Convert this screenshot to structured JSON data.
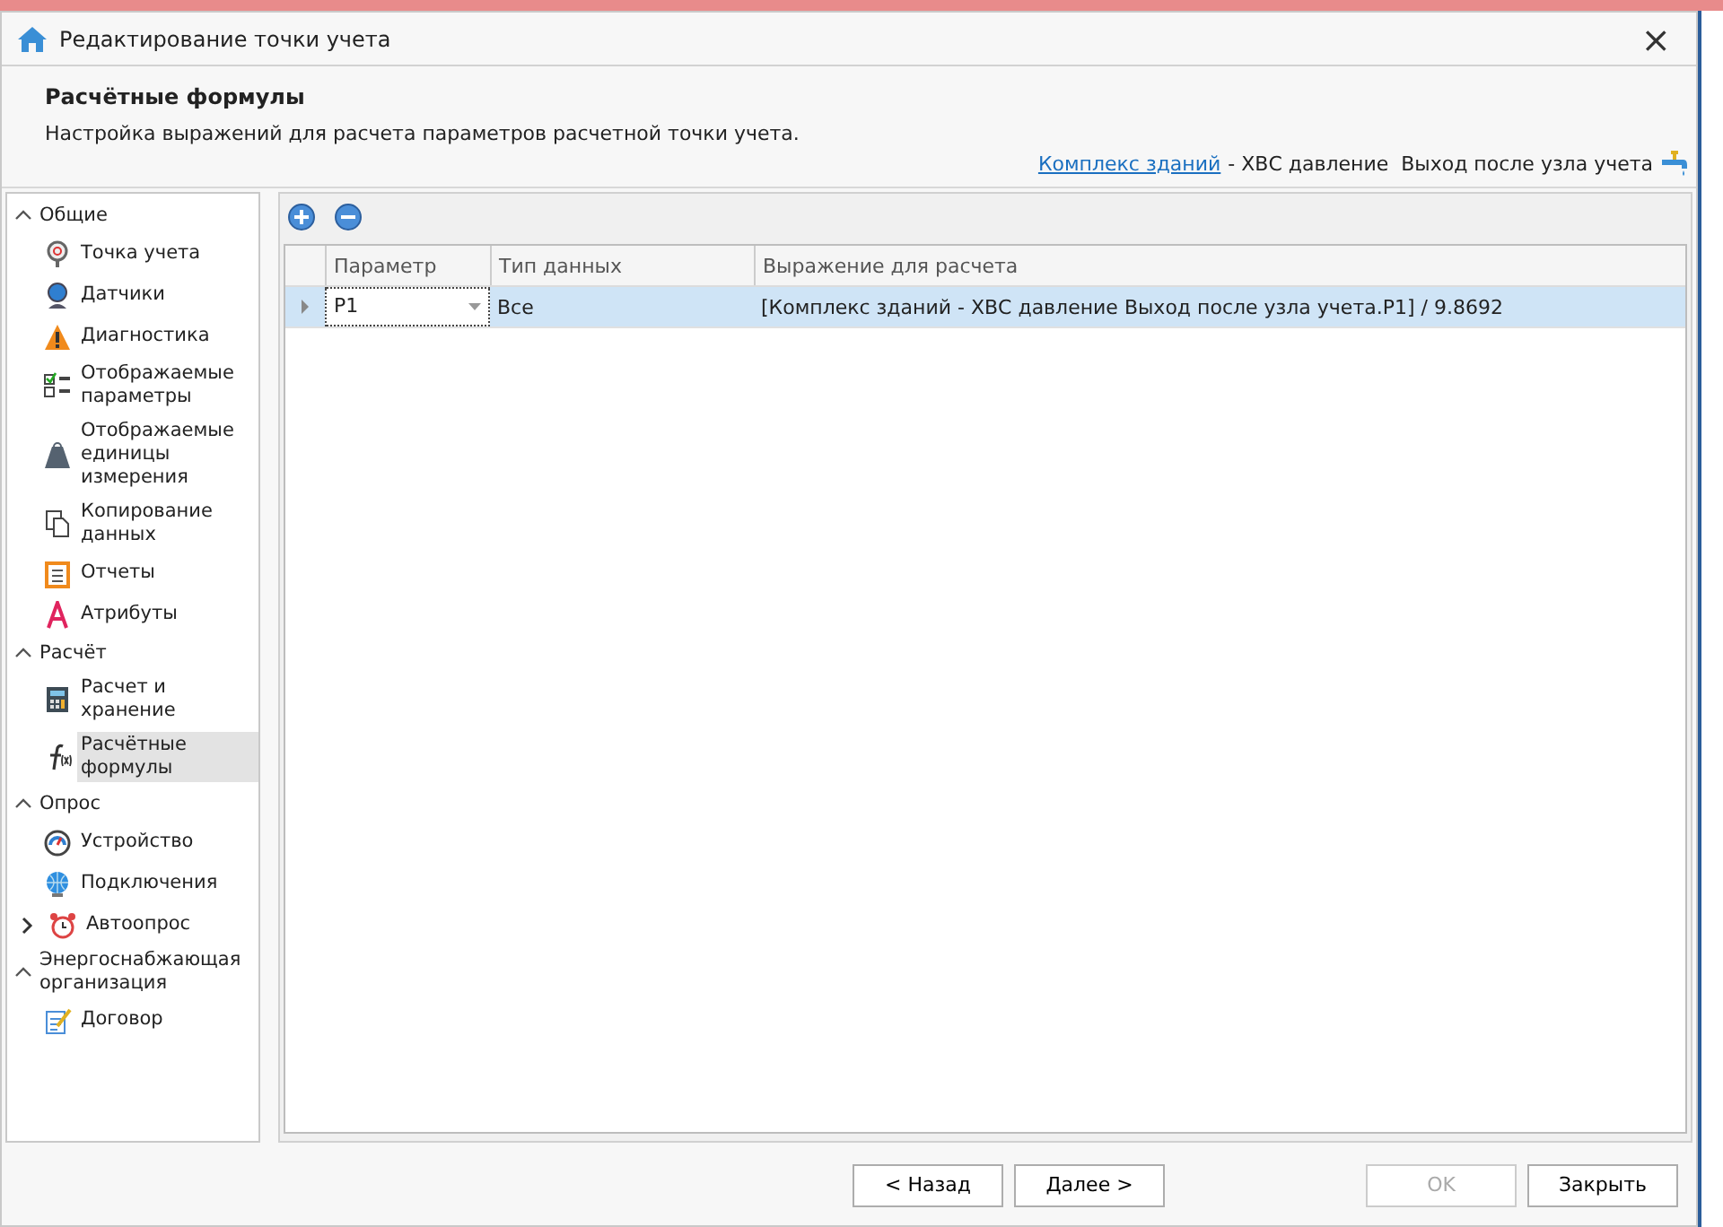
{
  "window": {
    "title": "Редактирование точки учета",
    "close": "×"
  },
  "header": {
    "title": "Расчётные формулы",
    "subtitle": "Настройка выражений для расчета параметров расчетной точки учета.",
    "link": "Комплекс зданий",
    "path": "- ХВС давление  Выход после узла учета"
  },
  "sidebar": {
    "groups": [
      {
        "label": "Общие",
        "expanded": true,
        "items": [
          {
            "label": "Точка учета",
            "selected": false
          },
          {
            "label": "Датчики",
            "selected": false
          },
          {
            "label": "Диагностика",
            "selected": false
          },
          {
            "label": "Отображаемые параметры",
            "selected": false
          },
          {
            "label": "Отображаемые единицы измерения",
            "selected": false
          },
          {
            "label": "Копирование данных",
            "selected": false
          },
          {
            "label": "Отчеты",
            "selected": false
          },
          {
            "label": "Атрибуты",
            "selected": false
          }
        ]
      },
      {
        "label": "Расчёт",
        "expanded": true,
        "items": [
          {
            "label": "Расчет и хранение",
            "selected": false
          },
          {
            "label": "Расчётные формулы",
            "selected": true
          }
        ]
      },
      {
        "label": "Опрос",
        "expanded": true,
        "items": [
          {
            "label": "Устройство",
            "selected": false
          },
          {
            "label": "Подключения",
            "selected": false
          },
          {
            "label": "Автоопрос",
            "selected": false,
            "expanded": false
          }
        ]
      },
      {
        "label": "Энергоснабжающая организация",
        "expanded": true,
        "items": [
          {
            "label": "Договор",
            "selected": false
          }
        ]
      }
    ]
  },
  "table": {
    "columns": [
      "Параметр",
      "Тип данных",
      "Выражение для расчета"
    ],
    "rows": [
      {
        "selected": true,
        "cells": [
          "P1",
          "Все",
          "[Комплекс зданий - ХВС давление  Выход после узла учета.P1] / 9.8692"
        ]
      }
    ]
  },
  "buttons": [
    {
      "label": "< Назад",
      "disabled": false
    },
    {
      "label": "Далее >",
      "disabled": false
    },
    {
      "label": "OK",
      "disabled": true
    },
    {
      "label": "Закрыть",
      "disabled": false
    }
  ]
}
